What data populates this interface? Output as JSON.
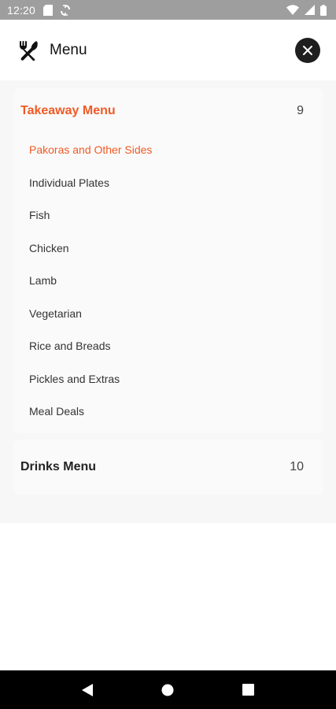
{
  "status_bar": {
    "time": "12:20",
    "icons": [
      "sd-card-icon",
      "sync-icon",
      "wifi-icon",
      "signal-icon",
      "battery-icon"
    ]
  },
  "header": {
    "icon": "fork-knife-icon",
    "title": "Menu",
    "close_icon": "close-icon"
  },
  "menu": {
    "categories": [
      {
        "title": "Takeaway Menu",
        "count": "9",
        "active": true,
        "items": [
          {
            "label": "Pakoras and Other Sides",
            "active": true
          },
          {
            "label": "Individual Plates"
          },
          {
            "label": "Fish"
          },
          {
            "label": "Chicken"
          },
          {
            "label": "Lamb"
          },
          {
            "label": "Vegetarian"
          },
          {
            "label": "Rice and Breads"
          },
          {
            "label": "Pickles and Extras"
          },
          {
            "label": "Meal Deals"
          }
        ]
      },
      {
        "title": "Drinks Menu",
        "count": "10",
        "active": false
      }
    ]
  },
  "nav_bar": {
    "icons": [
      "back-icon",
      "home-icon",
      "recents-icon"
    ]
  },
  "colors": {
    "accent": "#f05a24",
    "status_bar": "#9e9e9e",
    "panel_bg": "#f7f7f7"
  }
}
